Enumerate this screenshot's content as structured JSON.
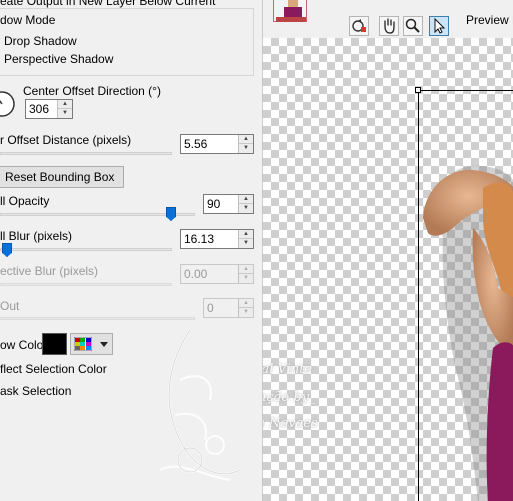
{
  "group": {
    "create_output": "eate Output in New Layer Below Current",
    "shadow_mode": "dow Mode",
    "drop_shadow": "Drop Shadow",
    "perspective_shadow": "Perspective Shadow"
  },
  "center_offset": {
    "label": "Center Offset Direction (°)",
    "value": "306"
  },
  "offset_distance": {
    "label": "r Offset Distance (pixels)",
    "value": "5.56"
  },
  "reset_button": "Reset Bounding Box",
  "opacity": {
    "label": "ll Opacity",
    "value": "90"
  },
  "blur": {
    "label": "ll Blur (pixels)",
    "value": "16.13"
  },
  "persp_blur": {
    "label": "ective Blur (pixels)",
    "value": "0.00"
  },
  "fade": {
    "label": "Out",
    "value": "0"
  },
  "shadow_color": {
    "label": "ow Color",
    "color": "#000000"
  },
  "reflect_selection": "flect Selection Color",
  "mask_selection": "ask Selection",
  "preview_label": "Preview B",
  "watermark": {
    "line1": "Tutorial Vinte",
    "line2": "Formatação by_",
    "line3": "Neusa Novaes"
  },
  "icons": [
    "reset-view-icon",
    "hand-icon",
    "zoom-icon",
    "arrow-pointer-icon",
    "color-grid-icon",
    "dropdown-arrow-icon"
  ]
}
